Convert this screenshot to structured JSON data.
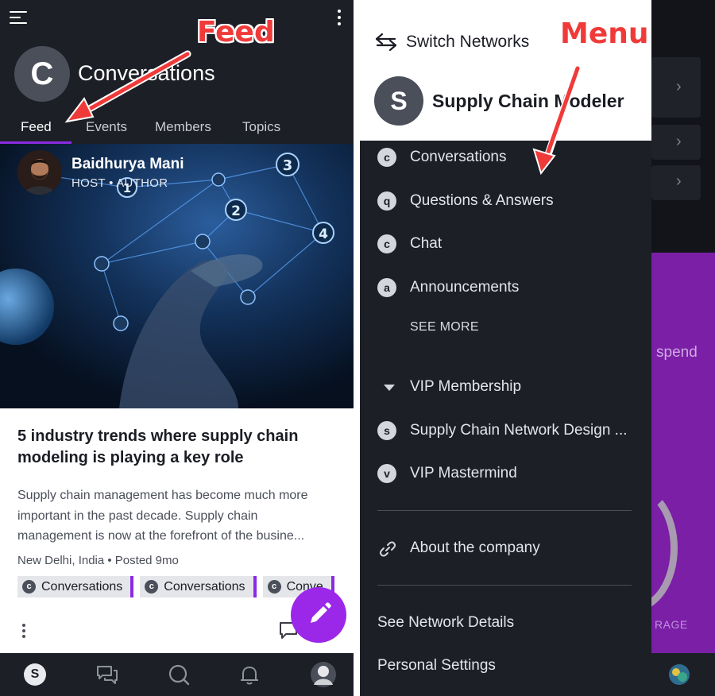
{
  "left_screen": {
    "group_avatar_letter": "C",
    "group_title": "Conversations",
    "tabs": [
      "Feed",
      "Events",
      "Members",
      "Topics"
    ],
    "active_tab": "Feed",
    "post": {
      "author_name": "Baidhurya Mani",
      "author_role": "HOST • AUTHOR",
      "image_numbers": [
        "3",
        "2",
        "4",
        "1"
      ],
      "title": "5 industry trends where supply chain modeling is playing a key role",
      "excerpt_lines": [
        "Supply chain management has become much more",
        "important in the past decade. Supply chain",
        "management is now at the forefront of the busine..."
      ],
      "meta": "New Delhi, India • Posted 9mo",
      "chips": [
        {
          "icon_letter": "c",
          "label": "Conversations"
        },
        {
          "icon_letter": "c",
          "label": "Conversations"
        },
        {
          "icon_letter": "c",
          "label": "Conve"
        }
      ]
    },
    "bottom_nav": {
      "network_letter": "S",
      "icons": [
        "chat-icon",
        "search-icon",
        "bell-icon",
        "profile-avatar"
      ]
    }
  },
  "right_screen": {
    "switch_networks_label": "Switch Networks",
    "network_avatar_letter": "S",
    "network_name": "Supply Chain Modeler",
    "menu_items": [
      {
        "icon_letter": "c",
        "label": "Conversations"
      },
      {
        "icon_letter": "q",
        "label": "Questions & Answers"
      },
      {
        "icon_letter": "c",
        "label": "Chat"
      },
      {
        "icon_letter": "a",
        "label": "Announcements"
      }
    ],
    "see_more_label": "SEE MORE",
    "vip_section": {
      "label": "VIP Membership",
      "items": [
        {
          "icon_letter": "s",
          "label": "Supply Chain Network Design ..."
        },
        {
          "icon_letter": "v",
          "label": "VIP Mastermind"
        }
      ]
    },
    "about_label": "About the company",
    "see_network_details_label": "See Network Details",
    "personal_settings_label": "Personal Settings",
    "background_partial_texts": {
      "spend": "spend",
      "rage": "RAGE"
    }
  },
  "annotations": {
    "feed": "Feed",
    "menu": "Menu",
    "color": "#f03a3a"
  },
  "colors": {
    "dark_bg": "#1c1f26",
    "accent_purple": "#8a2be2",
    "fab_purple": "#9b27e8"
  }
}
